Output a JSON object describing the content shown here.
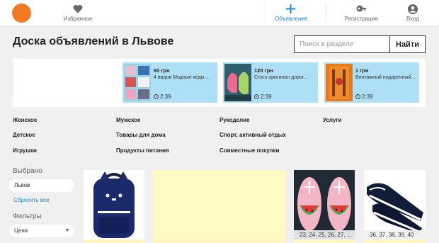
{
  "header": {
    "favorites_label": "Избранное",
    "post_ad_label": "Объявление",
    "register_label": "Регистрация",
    "login_label": "Вход"
  },
  "page": {
    "title": "Доска объявлений в Львове"
  },
  "search": {
    "placeholder": "Поиск в разделе",
    "button_label": "Найти"
  },
  "promo": [
    {
      "price": "60 грн",
      "title": "4 видов Модные кеды ...",
      "time": "2:39"
    },
    {
      "price": "120 грн",
      "title": "Crocs оригинал дорог...",
      "time": "2:39"
    },
    {
      "price": "1 грн",
      "title": "Винтажный подарочный...",
      "time": "2:39"
    }
  ],
  "categories": [
    [
      "Женское",
      "Мужское",
      "Рукоделие",
      "Услуги"
    ],
    [
      "Детское",
      "Товары для дома",
      "Спорт, активный отдых"
    ],
    [
      "Игрушки",
      "Продукты питания",
      "Совместные покупки"
    ]
  ],
  "sidebar": {
    "selected_label": "Выбрано",
    "selected_city": "Львов",
    "reset_label": "Сбросить все",
    "filters_label": "Фильтры",
    "price_select": "Цена"
  },
  "listings": [
    {
      "sizes": ""
    },
    {
      "sizes": ""
    },
    {
      "sizes": "23, 24, 25, 26, 27, ..."
    },
    {
      "sizes": "36, 37, 38, 39, 40"
    }
  ],
  "colors": {
    "accent": "#f47b24",
    "link": "#1e88d6",
    "promo_card": "#ade0f7",
    "placeholder_card": "#fff9c4"
  }
}
